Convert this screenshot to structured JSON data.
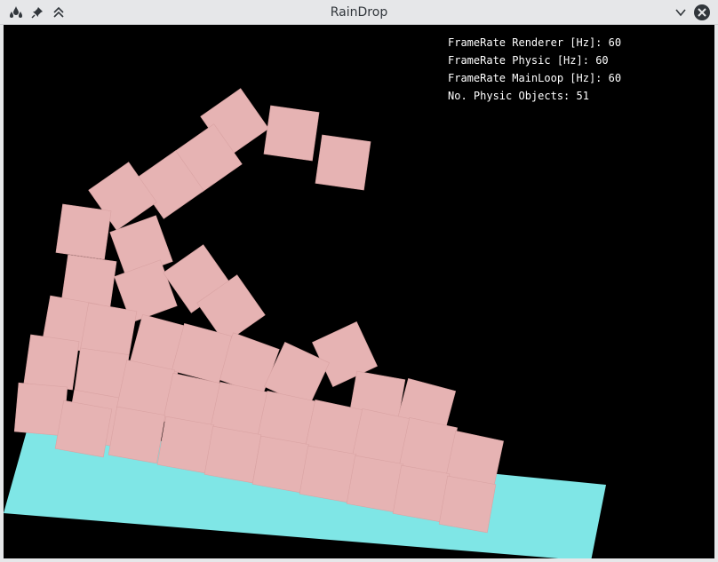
{
  "window": {
    "title": "RainDrop",
    "icons": [
      "app-icon",
      "pin-icon",
      "keep-above-icon",
      "minimize-chevron-icon",
      "close-icon"
    ]
  },
  "stats": {
    "renderer_label": "FrameRate Renderer [Hz]:",
    "renderer_value": "60",
    "physic_label": "FrameRate Physic [Hz]:",
    "physic_value": "60",
    "mainloop_label": "FrameRate MainLoop [Hz]:",
    "mainloop_value": "60",
    "objects_label": "No. Physic Objects:",
    "objects_value": "51"
  },
  "colors": {
    "box": "#e6b3b3",
    "ground": "#7fe6e6",
    "background": "#000000",
    "titlebar": "#e6e7e9"
  }
}
